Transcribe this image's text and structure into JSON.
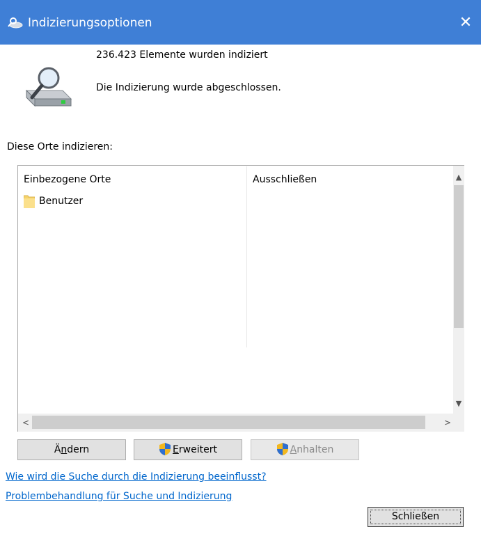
{
  "window": {
    "title": "Indizierungsoptionen",
    "close_glyph": "✕",
    "app_icon": "indexing-options-icon"
  },
  "status": {
    "icon": "drive-magnifier-icon",
    "count_text": "236.423 Elemente wurden indiziert",
    "progress_text": "Die Indizierung wurde abgeschlossen."
  },
  "locations": {
    "label": "Diese Orte indizieren:",
    "columns": {
      "included": "Einbezogene Orte",
      "exclude": "Ausschließen"
    },
    "items": [
      {
        "name": "Benutzer",
        "icon": "folder-icon",
        "exclude": ""
      }
    ]
  },
  "buttons": {
    "change": {
      "prefix": "Ä",
      "accel": "n",
      "suffix": "dern"
    },
    "advanced": {
      "accel": "E",
      "suffix": "rweitert",
      "icon": "uac-shield-icon"
    },
    "pause": {
      "accel": "A",
      "suffix": "nhalten",
      "icon": "uac-shield-icon",
      "disabled": true
    },
    "close": {
      "label": "Schließen"
    }
  },
  "links": {
    "how_indexing_affects": "Wie wird die Suche durch die Indizierung beeinflusst?",
    "troubleshoot": "Problembehandlung für Suche und Indizierung"
  },
  "scrollbars": {
    "up": "▲",
    "down": "▼",
    "left": "<",
    "right": ">"
  },
  "colors": {
    "titlebar": "#3f7fd6",
    "link": "#0066cc"
  }
}
